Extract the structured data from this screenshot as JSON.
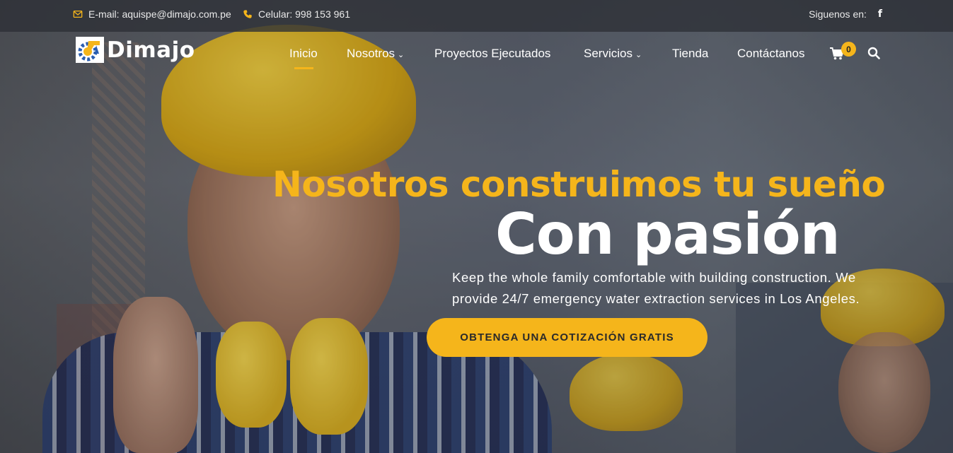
{
  "topbar": {
    "email_text": "E-mail: aquispe@dimajo.com.pe",
    "phone_text": "Celular: 998 153 961",
    "social_label": "Siguenos en:",
    "social_icon": "facebook-icon"
  },
  "header": {
    "logo_text": "Dimajo",
    "nav": {
      "inicio": "Inicio",
      "nosotros": "Nosotros",
      "proyectos": "Proyectos Ejecutados",
      "servicios": "Servicios",
      "tienda": "Tienda",
      "contactanos": "Contáctanos"
    },
    "cart_count": "0"
  },
  "hero": {
    "headline": "Nosotros construimos tu sueño",
    "subheadline": "Con pasión",
    "description": "Keep the whole family comfortable with building construction. We provide 24/7 emergency water extraction services in Los Angeles.",
    "cta_label": "OBTENGA UNA COTIZACIÓN GRATIS"
  },
  "colors": {
    "accent": "#f5b51b",
    "topbar_bg": "#2d3036",
    "text_light": "#ffffff"
  }
}
